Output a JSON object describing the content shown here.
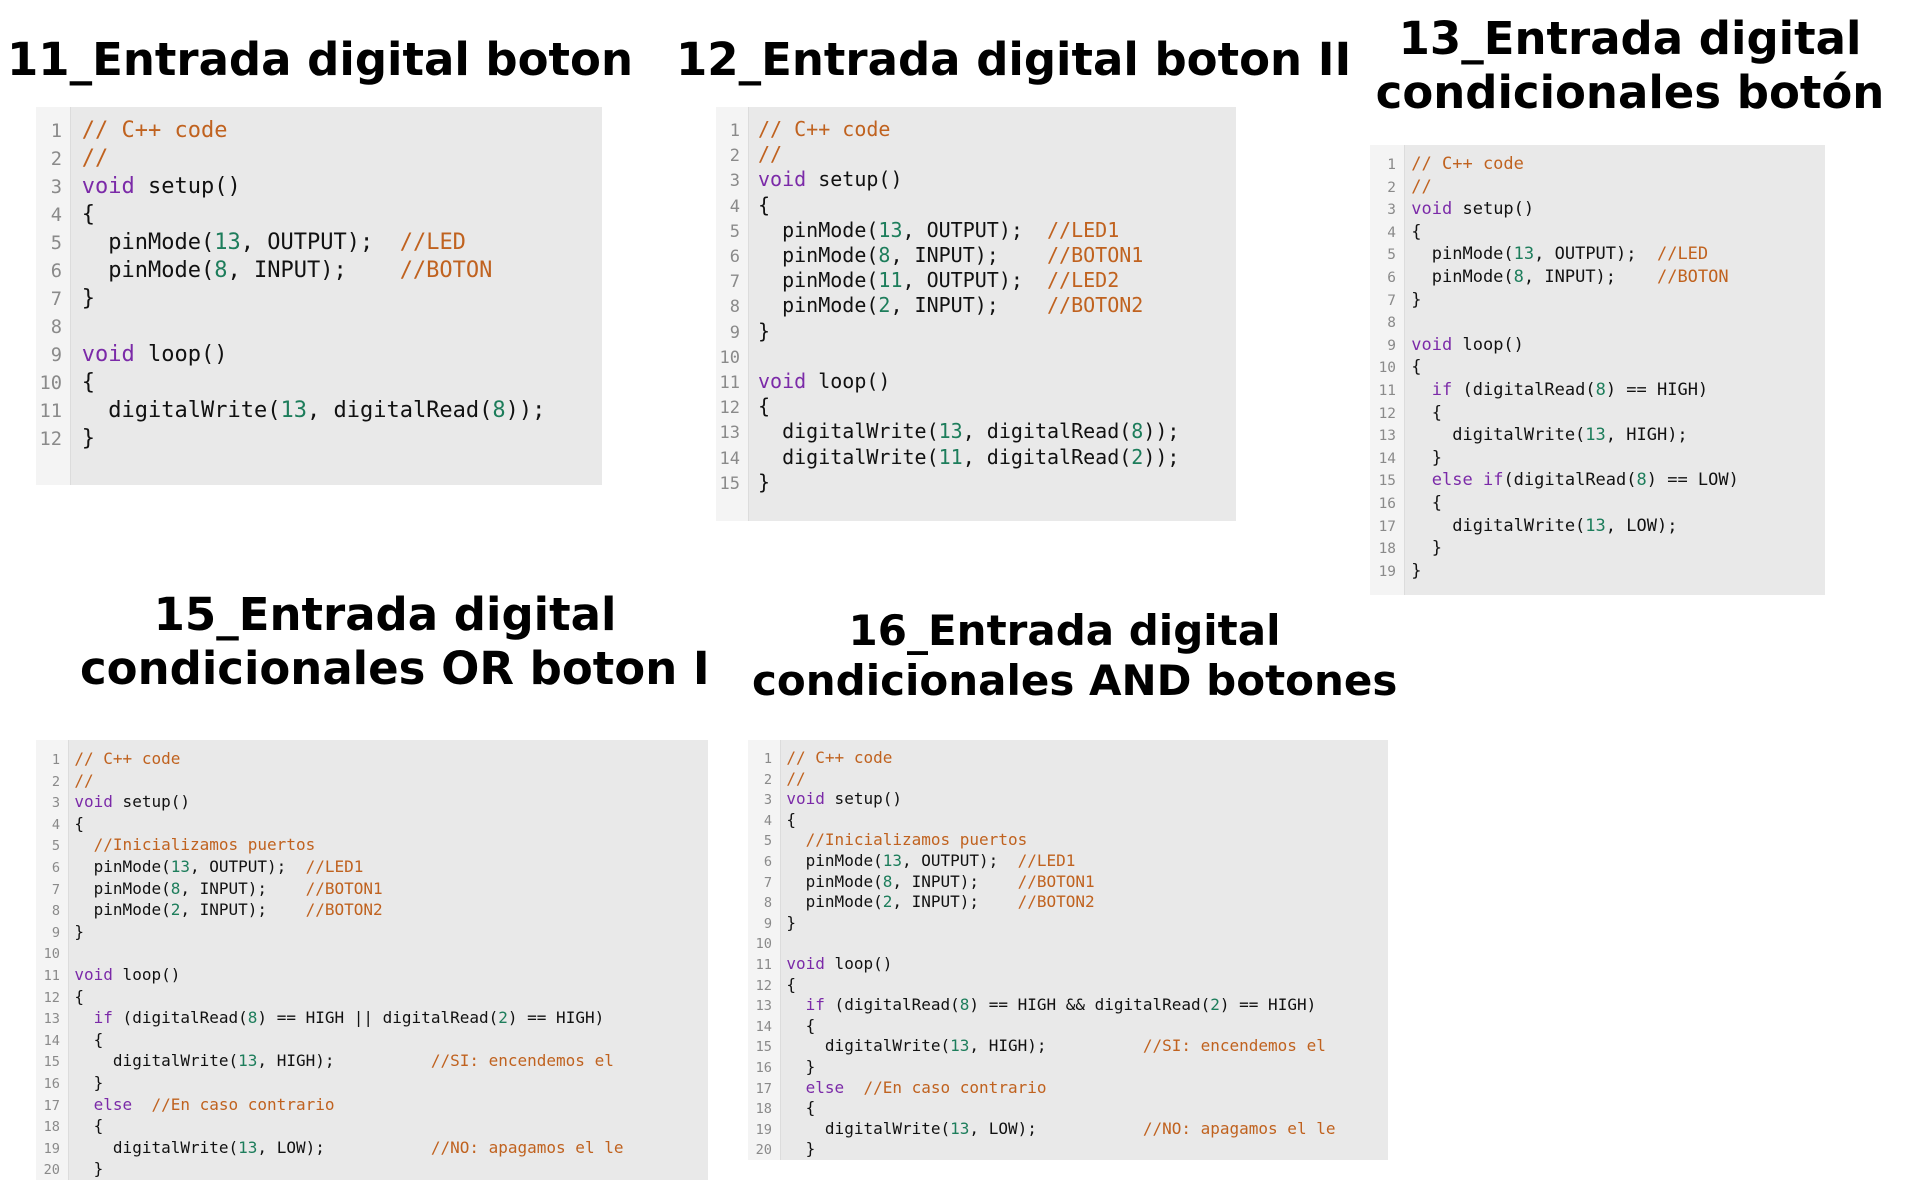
{
  "panels": [
    {
      "id": "p11",
      "title_lines": [
        "11_Entrada digital boton"
      ],
      "code": [
        [
          [
            "cm",
            "// C++ code"
          ]
        ],
        [
          [
            "cm",
            "//"
          ]
        ],
        [
          [
            "kw",
            "void"
          ],
          [
            "tx",
            " setup()"
          ]
        ],
        [
          [
            "tx",
            "{"
          ]
        ],
        [
          [
            "tx",
            "  pinMode("
          ],
          [
            "num",
            "13"
          ],
          [
            "tx",
            ", OUTPUT);  "
          ],
          [
            "cm",
            "//LED"
          ]
        ],
        [
          [
            "tx",
            "  pinMode("
          ],
          [
            "num",
            "8"
          ],
          [
            "tx",
            ", INPUT);    "
          ],
          [
            "cm",
            "//BOTON"
          ]
        ],
        [
          [
            "tx",
            "}"
          ]
        ],
        [],
        [
          [
            "kw",
            "void"
          ],
          [
            "tx",
            " loop()"
          ]
        ],
        [
          [
            "tx",
            "{"
          ]
        ],
        [
          [
            "tx",
            "  digitalWrite("
          ],
          [
            "num",
            "13"
          ],
          [
            "tx",
            ", digitalRead("
          ],
          [
            "num",
            "8"
          ],
          [
            "tx",
            "));"
          ]
        ],
        [
          [
            "tx",
            "}"
          ]
        ]
      ]
    },
    {
      "id": "p12",
      "title_lines": [
        "12_Entrada digital boton II"
      ],
      "code": [
        [
          [
            "cm",
            "// C++ code"
          ]
        ],
        [
          [
            "cm",
            "//"
          ]
        ],
        [
          [
            "kw",
            "void"
          ],
          [
            "tx",
            " setup()"
          ]
        ],
        [
          [
            "tx",
            "{"
          ]
        ],
        [
          [
            "tx",
            "  pinMode("
          ],
          [
            "num",
            "13"
          ],
          [
            "tx",
            ", OUTPUT);  "
          ],
          [
            "cm",
            "//LED1"
          ]
        ],
        [
          [
            "tx",
            "  pinMode("
          ],
          [
            "num",
            "8"
          ],
          [
            "tx",
            ", INPUT);    "
          ],
          [
            "cm",
            "//BOTON1"
          ]
        ],
        [
          [
            "tx",
            "  pinMode("
          ],
          [
            "num",
            "11"
          ],
          [
            "tx",
            ", OUTPUT);  "
          ],
          [
            "cm",
            "//LED2"
          ]
        ],
        [
          [
            "tx",
            "  pinMode("
          ],
          [
            "num",
            "2"
          ],
          [
            "tx",
            ", INPUT);    "
          ],
          [
            "cm",
            "//BOTON2"
          ]
        ],
        [
          [
            "tx",
            "}"
          ]
        ],
        [],
        [
          [
            "kw",
            "void"
          ],
          [
            "tx",
            " loop()"
          ]
        ],
        [
          [
            "tx",
            "{"
          ]
        ],
        [
          [
            "tx",
            "  digitalWrite("
          ],
          [
            "num",
            "13"
          ],
          [
            "tx",
            ", digitalRead("
          ],
          [
            "num",
            "8"
          ],
          [
            "tx",
            "));"
          ]
        ],
        [
          [
            "tx",
            "  digitalWrite("
          ],
          [
            "num",
            "11"
          ],
          [
            "tx",
            ", digitalRead("
          ],
          [
            "num",
            "2"
          ],
          [
            "tx",
            "));"
          ]
        ],
        [
          [
            "tx",
            "}"
          ]
        ]
      ]
    },
    {
      "id": "p13",
      "title_lines": [
        "13_Entrada digital",
        "condicionales botón"
      ],
      "code": [
        [
          [
            "cm",
            "// C++ code"
          ]
        ],
        [
          [
            "cm",
            "//"
          ]
        ],
        [
          [
            "kw",
            "void"
          ],
          [
            "tx",
            " setup()"
          ]
        ],
        [
          [
            "tx",
            "{"
          ]
        ],
        [
          [
            "tx",
            "  pinMode("
          ],
          [
            "num",
            "13"
          ],
          [
            "tx",
            ", OUTPUT);  "
          ],
          [
            "cm",
            "//LED"
          ]
        ],
        [
          [
            "tx",
            "  pinMode("
          ],
          [
            "num",
            "8"
          ],
          [
            "tx",
            ", INPUT);    "
          ],
          [
            "cm",
            "//BOTON"
          ]
        ],
        [
          [
            "tx",
            "}"
          ]
        ],
        [],
        [
          [
            "kw",
            "void"
          ],
          [
            "tx",
            " loop()"
          ]
        ],
        [
          [
            "tx",
            "{"
          ]
        ],
        [
          [
            "tx",
            "  "
          ],
          [
            "kw",
            "if"
          ],
          [
            "tx",
            " (digitalRead("
          ],
          [
            "num",
            "8"
          ],
          [
            "tx",
            ") == HIGH)"
          ]
        ],
        [
          [
            "tx",
            "  {"
          ]
        ],
        [
          [
            "tx",
            "    digitalWrite("
          ],
          [
            "num",
            "13"
          ],
          [
            "tx",
            ", HIGH);"
          ]
        ],
        [
          [
            "tx",
            "  }"
          ]
        ],
        [
          [
            "tx",
            "  "
          ],
          [
            "kw",
            "else if"
          ],
          [
            "tx",
            "(digitalRead("
          ],
          [
            "num",
            "8"
          ],
          [
            "tx",
            ") == LOW)"
          ]
        ],
        [
          [
            "tx",
            "  {"
          ]
        ],
        [
          [
            "tx",
            "    digitalWrite("
          ],
          [
            "num",
            "13"
          ],
          [
            "tx",
            ", LOW);"
          ]
        ],
        [
          [
            "tx",
            "  }"
          ]
        ],
        [
          [
            "tx",
            "}"
          ]
        ]
      ]
    },
    {
      "id": "p15",
      "title_lines": [
        "15_Entrada digital",
        "condicionales OR boton I"
      ],
      "code": [
        [
          [
            "cm",
            "// C++ code"
          ]
        ],
        [
          [
            "cm",
            "//"
          ]
        ],
        [
          [
            "kw",
            "void"
          ],
          [
            "tx",
            " setup()"
          ]
        ],
        [
          [
            "tx",
            "{"
          ]
        ],
        [
          [
            "tx",
            "  "
          ],
          [
            "cm",
            "//Inicializamos puertos"
          ]
        ],
        [
          [
            "tx",
            "  pinMode("
          ],
          [
            "num",
            "13"
          ],
          [
            "tx",
            ", OUTPUT);  "
          ],
          [
            "cm",
            "//LED1"
          ]
        ],
        [
          [
            "tx",
            "  pinMode("
          ],
          [
            "num",
            "8"
          ],
          [
            "tx",
            ", INPUT);    "
          ],
          [
            "cm",
            "//BOTON1"
          ]
        ],
        [
          [
            "tx",
            "  pinMode("
          ],
          [
            "num",
            "2"
          ],
          [
            "tx",
            ", INPUT);    "
          ],
          [
            "cm",
            "//BOTON2"
          ]
        ],
        [
          [
            "tx",
            "}"
          ]
        ],
        [],
        [
          [
            "kw",
            "void"
          ],
          [
            "tx",
            " loop()"
          ]
        ],
        [
          [
            "tx",
            "{"
          ]
        ],
        [
          [
            "tx",
            "  "
          ],
          [
            "kw",
            "if"
          ],
          [
            "tx",
            " (digitalRead("
          ],
          [
            "num",
            "8"
          ],
          [
            "tx",
            ") == HIGH || digitalRead("
          ],
          [
            "num",
            "2"
          ],
          [
            "tx",
            ") == HIGH)"
          ]
        ],
        [
          [
            "tx",
            "  {"
          ]
        ],
        [
          [
            "tx",
            "    digitalWrite("
          ],
          [
            "num",
            "13"
          ],
          [
            "tx",
            ", HIGH);          "
          ],
          [
            "cm",
            "//SI: encendemos el"
          ]
        ],
        [
          [
            "tx",
            "  }"
          ]
        ],
        [
          [
            "tx",
            "  "
          ],
          [
            "kw",
            "else"
          ],
          [
            "tx",
            "  "
          ],
          [
            "cm",
            "//En caso contrario"
          ]
        ],
        [
          [
            "tx",
            "  {"
          ]
        ],
        [
          [
            "tx",
            "    digitalWrite("
          ],
          [
            "num",
            "13"
          ],
          [
            "tx",
            ", LOW);           "
          ],
          [
            "cm",
            "//NO: apagamos el le"
          ]
        ],
        [
          [
            "tx",
            "  }"
          ]
        ]
      ]
    },
    {
      "id": "p16",
      "title_lines": [
        "16_Entrada digital",
        "condicionales AND botones"
      ],
      "code": [
        [
          [
            "cm",
            "// C++ code"
          ]
        ],
        [
          [
            "cm",
            "//"
          ]
        ],
        [
          [
            "kw",
            "void"
          ],
          [
            "tx",
            " setup()"
          ]
        ],
        [
          [
            "tx",
            "{"
          ]
        ],
        [
          [
            "tx",
            "  "
          ],
          [
            "cm",
            "//Inicializamos puertos"
          ]
        ],
        [
          [
            "tx",
            "  pinMode("
          ],
          [
            "num",
            "13"
          ],
          [
            "tx",
            ", OUTPUT);  "
          ],
          [
            "cm",
            "//LED1"
          ]
        ],
        [
          [
            "tx",
            "  pinMode("
          ],
          [
            "num",
            "8"
          ],
          [
            "tx",
            ", INPUT);    "
          ],
          [
            "cm",
            "//BOTON1"
          ]
        ],
        [
          [
            "tx",
            "  pinMode("
          ],
          [
            "num",
            "2"
          ],
          [
            "tx",
            ", INPUT);    "
          ],
          [
            "cm",
            "//BOTON2"
          ]
        ],
        [
          [
            "tx",
            "}"
          ]
        ],
        [],
        [
          [
            "kw",
            "void"
          ],
          [
            "tx",
            " loop()"
          ]
        ],
        [
          [
            "tx",
            "{"
          ]
        ],
        [
          [
            "tx",
            "  "
          ],
          [
            "kw",
            "if"
          ],
          [
            "tx",
            " (digitalRead("
          ],
          [
            "num",
            "8"
          ],
          [
            "tx",
            ") == HIGH && digitalRead("
          ],
          [
            "num",
            "2"
          ],
          [
            "tx",
            ") == HIGH)"
          ]
        ],
        [
          [
            "tx",
            "  {"
          ]
        ],
        [
          [
            "tx",
            "    digitalWrite("
          ],
          [
            "num",
            "13"
          ],
          [
            "tx",
            ", HIGH);          "
          ],
          [
            "cm",
            "//SI: encendemos el"
          ]
        ],
        [
          [
            "tx",
            "  }"
          ]
        ],
        [
          [
            "tx",
            "  "
          ],
          [
            "kw",
            "else"
          ],
          [
            "tx",
            "  "
          ],
          [
            "cm",
            "//En caso contrario"
          ]
        ],
        [
          [
            "tx",
            "  {"
          ]
        ],
        [
          [
            "tx",
            "    digitalWrite("
          ],
          [
            "num",
            "13"
          ],
          [
            "tx",
            ", LOW);           "
          ],
          [
            "cm",
            "//NO: apagamos el le"
          ]
        ],
        [
          [
            "tx",
            "  }"
          ]
        ]
      ]
    }
  ],
  "colors": {
    "keyword": "#7b2aa8",
    "number": "#1d7d5b",
    "comment": "#c0621f",
    "text": "#111111",
    "code_background": "#e9e9e9",
    "gutter_background": "#f4f4f4",
    "line_number": "#8a8a8a"
  }
}
